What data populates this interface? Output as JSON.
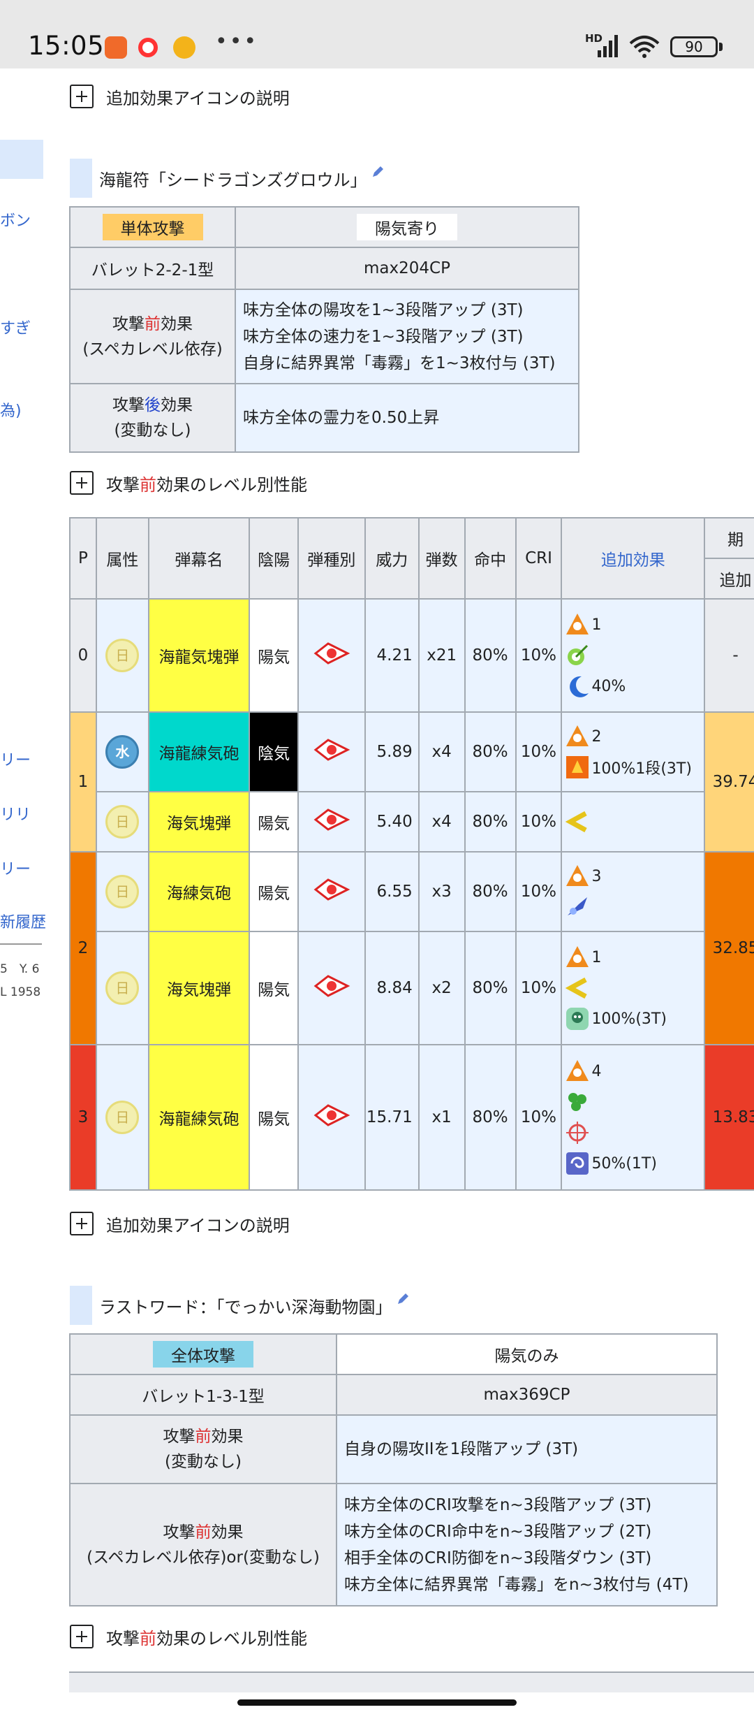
{
  "status": {
    "time": "15:05",
    "battery": "90",
    "network": "HD",
    "dots": "•••"
  },
  "sidebar": {
    "items": [
      "ボン",
      "すぎ",
      "為)",
      "リー",
      "リリ",
      "リー",
      "新履歴"
    ],
    "small": [
      "5　Y. 6",
      "L 1958"
    ]
  },
  "section1": {
    "icon_expand_label": "追加効果アイコンの説明",
    "title": "海龍符「シードラゴンズグロウル」",
    "info": {
      "attack_type": "単体攻撃",
      "yinyang": "陽気寄り",
      "barrett": "バレット2-2-1型",
      "cp": "max204CP",
      "pre_label": [
        "攻撃",
        "前",
        "効果"
      ],
      "pre_sub": "(スペカレベル依存)",
      "pre_effects": [
        "味方全体の陽攻を1~3段階アップ (3T)",
        "味方全体の速力を1~3段階アップ (3T)",
        "自身に結界異常「毒霧」を1~3枚付与 (3T)"
      ],
      "post_label": [
        "攻撃",
        "後",
        "効果"
      ],
      "post_sub": "(変動なし)",
      "post_effect": "味方全体の霊力を0.50上昇"
    },
    "level_expand_label": [
      "攻撃",
      "前",
      "効果のレベル別性能"
    ],
    "headers": [
      "P",
      "属性",
      "弾幕名",
      "陰陽",
      "弾種別",
      "威力",
      "弾数",
      "命中",
      "CRI",
      "追加効果",
      "期",
      "追加"
    ],
    "rows": [
      {
        "p": "0",
        "attr": "日",
        "name": "海龍気塊弾",
        "yy": "陽気",
        "power": "4.21",
        "count": "x21",
        "hit": "80%",
        "cri": "10%",
        "eff": [
          "1",
          "",
          "40%"
        ],
        "extra": "-"
      },
      {
        "p": "1",
        "attr": "水",
        "name": "海龍練気砲",
        "yy": "陰気",
        "power": "5.89",
        "count": "x4",
        "hit": "80%",
        "cri": "10%",
        "eff": [
          "2",
          "100%1段(3T)"
        ],
        "extra": "39.74"
      },
      {
        "p": "",
        "attr": "日",
        "name": "海気塊弾",
        "yy": "陽気",
        "power": "5.40",
        "count": "x4",
        "hit": "80%",
        "cri": "10%",
        "eff": [
          ""
        ]
      },
      {
        "p": "2",
        "attr": "日",
        "name": "海練気砲",
        "yy": "陽気",
        "power": "6.55",
        "count": "x3",
        "hit": "80%",
        "cri": "10%",
        "eff": [
          "3",
          ""
        ],
        "extra": "32.85"
      },
      {
        "p": "",
        "attr": "日",
        "name": "海気塊弾",
        "yy": "陽気",
        "power": "8.84",
        "count": "x2",
        "hit": "80%",
        "cri": "10%",
        "eff": [
          "1",
          "",
          "100%(3T)"
        ]
      },
      {
        "p": "3",
        "attr": "日",
        "name": "海龍練気砲",
        "yy": "陽気",
        "power": "15.71",
        "count": "x1",
        "hit": "80%",
        "cri": "10%",
        "eff": [
          "4",
          "",
          "",
          "50%(1T)"
        ],
        "extra": "13.83"
      }
    ],
    "colors": {
      "p0": "#eaecf0",
      "p1": "#ffd57a",
      "p2": "#f07800",
      "p3": "#ea3c28"
    }
  },
  "section2": {
    "icon_expand_label": "追加効果アイコンの説明",
    "title": "ラストワード：「でっかい深海動物園」",
    "info": {
      "attack_type": "全体攻撃",
      "yinyang": "陽気のみ",
      "barrett": "バレット1-3-1型",
      "cp": "max369CP",
      "pre1_label": [
        "攻撃",
        "前",
        "効果"
      ],
      "pre1_sub": "(変動なし)",
      "pre1_effect": "自身の陽攻IIを1段階アップ (3T)",
      "pre2_label": [
        "攻撃",
        "前",
        "効果"
      ],
      "pre2_sub": "(スペカレベル依存)or(変動なし)",
      "pre2_effects": [
        "味方全体のCRI攻撃をn~3段階アップ (3T)",
        "味方全体のCRI命中をn~3段階アップ (2T)",
        "相手全体のCRI防御をn~3段階ダウン (3T)",
        "味方全体に結界異常「毒霧」をn~3枚付与 (4T)"
      ]
    },
    "level_expand_label": [
      "攻撃",
      "前",
      "効果のレベル別性能"
    ]
  }
}
